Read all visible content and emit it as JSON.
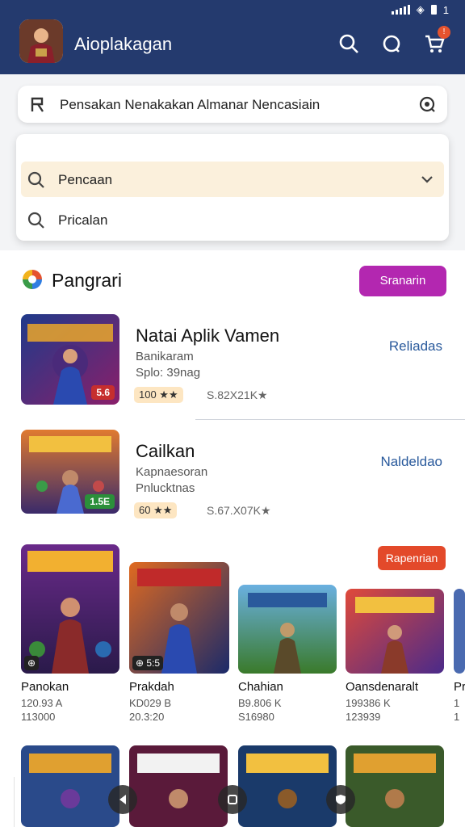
{
  "app": {
    "title": "Aioplakagan"
  },
  "status": {
    "right_text": "1"
  },
  "search": {
    "text": "Pensakan Nenakakan Almanar Nencasiain"
  },
  "dropdown": {
    "items": [
      {
        "label": "Pencaan",
        "selected": true
      },
      {
        "label": "Pricalan",
        "selected": false
      }
    ]
  },
  "section": {
    "title": "Pangrari",
    "button": "Sranarin"
  },
  "list": [
    {
      "title": "Natai Aplik Vamen",
      "line2": "Banikaram",
      "line3": "Splo: 39nag",
      "rating": "100 ★★",
      "meta": "S.82X21K★",
      "action": "Reliadas",
      "thumb_text": "DANILOLAN",
      "price": "5.6"
    },
    {
      "title": "Cailkan",
      "line2": "Kapnaesoran",
      "line3": "Pnlucktnas",
      "rating": "60 ★★",
      "meta": "S.67.X07K★",
      "action": "Naldeldao",
      "thumb_text": "TOMSLEAN",
      "price": "1.5E"
    }
  ],
  "tag_button": "Rapenrian",
  "grid": [
    {
      "title": "Panokan",
      "line1": "120.93 A",
      "line2": "113000",
      "art": "KORIKLLAN",
      "corner": "⊕"
    },
    {
      "title": "Prakdah",
      "line1": "KD029 B",
      "line2": "20.3:20",
      "art": "HORCAR",
      "corner": "⊕ 5:5"
    },
    {
      "title": "Chahian",
      "line1": "B9.806 K",
      "line2": "S16980",
      "art": "NENCHOLK",
      "corner": ""
    },
    {
      "title": "Oansdenaralt",
      "line1": "199386 K",
      "line2": "123939",
      "art": "MAPLOHN",
      "corner": ""
    },
    {
      "title": "Pr",
      "line1": "1",
      "line2": "1",
      "art": "",
      "corner": ""
    }
  ],
  "grid_row2": [
    {
      "art": "VARKILL"
    },
    {
      "art": "DAODOK"
    },
    {
      "art": "PAUWAR"
    },
    {
      "art": "NASOOAK"
    }
  ],
  "colors": {
    "header": "#243a6e",
    "accent_purple": "#b327b0",
    "accent_red": "#e3492a",
    "link_blue": "#2a5a9c"
  }
}
